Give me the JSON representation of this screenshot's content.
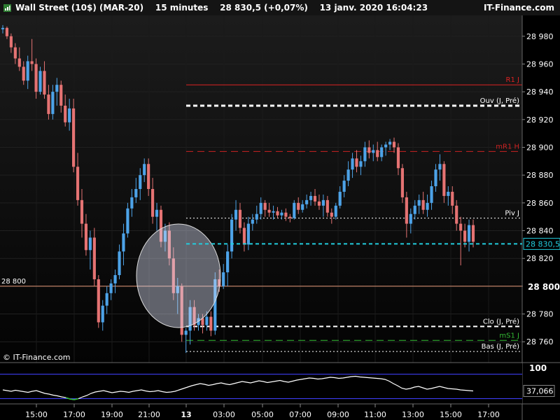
{
  "header": {
    "instrument": "Wall Street (10$) (MAR-20)",
    "timeframe": "15 minutes",
    "price": "28 830,5 (+0,07%)",
    "datetime": "13 janv. 2020 16:04:23",
    "brand": "IT-Finance.com"
  },
  "watermark": "© IT-Finance.com",
  "colors": {
    "up": "#4da3e8",
    "down": "#e57373",
    "background": "#000000",
    "oscillator": "#ffffff",
    "osc_band": "#4040ff",
    "last_price": "#22ccdd"
  },
  "chart_data": [
    {
      "type": "candlestick",
      "name": "Wall Street (10$) (MAR-20)",
      "ylim": [
        28745,
        28995
      ],
      "y_ticks": [
        28980,
        28960,
        28940,
        28920,
        28900,
        28880,
        28860,
        28840,
        28820,
        28800,
        28780,
        28760
      ],
      "y_tick_labels": [
        "28 980",
        "28 960",
        "28 940",
        "28 920",
        "28 900",
        "28 880",
        "28 860",
        "28 840",
        "28 820",
        "28 800",
        "28 780",
        "28 760"
      ],
      "x_labels": [
        "15:00",
        "17:00",
        "19:00",
        "21:00",
        "13",
        "03:00",
        "05:00",
        "07:00",
        "09:00",
        "11:00",
        "13:00",
        "15:00",
        "17:00"
      ],
      "last_price": 28830.5,
      "last_price_label": "28 830,5",
      "candles": [
        [
          28985,
          28988,
          28982,
          28986
        ],
        [
          28986,
          28987,
          28978,
          28980
        ],
        [
          28980,
          28982,
          28968,
          28972
        ],
        [
          28972,
          28975,
          28960,
          28964
        ],
        [
          28964,
          28972,
          28955,
          28958
        ],
        [
          28958,
          28962,
          28945,
          28948
        ],
        [
          28948,
          28966,
          28942,
          28962
        ],
        [
          28962,
          28978,
          28955,
          28960
        ],
        [
          28960,
          28964,
          28935,
          28940
        ],
        [
          28940,
          28958,
          28938,
          28955
        ],
        [
          28955,
          28962,
          28935,
          28938
        ],
        [
          28938,
          28945,
          28920,
          28924
        ],
        [
          28924,
          28945,
          28920,
          28940
        ],
        [
          28940,
          28950,
          28930,
          28945
        ],
        [
          28945,
          28948,
          28925,
          28930
        ],
        [
          28930,
          28938,
          28915,
          28918
        ],
        [
          28918,
          28935,
          28912,
          28928
        ],
        [
          28928,
          28935,
          28882,
          28886
        ],
        [
          28886,
          28896,
          28858,
          28862
        ],
        [
          28862,
          28870,
          28835,
          28845
        ],
        [
          28845,
          28852,
          28822,
          28826
        ],
        [
          28826,
          28840,
          28812,
          28835
        ],
        [
          28835,
          28842,
          28800,
          28805
        ],
        [
          28805,
          28808,
          28770,
          28774
        ],
        [
          28774,
          28790,
          28768,
          28786
        ],
        [
          28786,
          28800,
          28780,
          28795
        ],
        [
          28795,
          28805,
          28790,
          28802
        ],
        [
          28802,
          28812,
          28795,
          28808
        ],
        [
          28808,
          28830,
          28805,
          28825
        ],
        [
          28825,
          28845,
          28815,
          28838
        ],
        [
          28838,
          28860,
          28835,
          28856
        ],
        [
          28856,
          28870,
          28850,
          28864
        ],
        [
          28864,
          28878,
          28860,
          28870
        ],
        [
          28870,
          28885,
          28862,
          28880
        ],
        [
          28880,
          28892,
          28875,
          28888
        ],
        [
          28888,
          28892,
          28865,
          28870
        ],
        [
          28870,
          28878,
          28845,
          28850
        ],
        [
          28850,
          28860,
          28840,
          28855
        ],
        [
          28855,
          28858,
          28828,
          28832
        ],
        [
          28832,
          28845,
          28825,
          28840
        ],
        [
          28840,
          28846,
          28815,
          28820
        ],
        [
          28820,
          28828,
          28790,
          28795
        ],
        [
          28795,
          28806,
          28780,
          28800
        ],
        [
          28800,
          28802,
          28760,
          28765
        ],
        [
          28765,
          28770,
          28752,
          28768
        ],
        [
          28768,
          28790,
          28758,
          28785
        ],
        [
          28785,
          28790,
          28768,
          28772
        ],
        [
          28772,
          28780,
          28768,
          28777
        ],
        [
          28777,
          28780,
          28766,
          28772
        ],
        [
          28772,
          28782,
          28768,
          28778
        ],
        [
          28778,
          28782,
          28764,
          28768
        ],
        [
          28768,
          28810,
          28765,
          28805
        ],
        [
          28805,
          28812,
          28796,
          28800
        ],
        [
          28800,
          28816,
          28798,
          28810
        ],
        [
          28810,
          28830,
          28800,
          28825
        ],
        [
          28825,
          28852,
          28820,
          28848
        ],
        [
          28848,
          28862,
          28840,
          28855
        ],
        [
          28855,
          28860,
          28838,
          28842
        ],
        [
          28842,
          28846,
          28825,
          28830
        ],
        [
          28830,
          28850,
          28826,
          28845
        ],
        [
          28845,
          28852,
          28840,
          28848
        ],
        [
          28848,
          28858,
          28845,
          28852
        ],
        [
          28852,
          28864,
          28848,
          28860
        ],
        [
          28860,
          28862,
          28850,
          28855
        ],
        [
          28855,
          28860,
          28850,
          28853
        ],
        [
          28853,
          28858,
          28848,
          28854
        ],
        [
          28854,
          28857,
          28849,
          28851
        ],
        [
          28851,
          28855,
          28848,
          28853
        ],
        [
          28853,
          28856,
          28847,
          28850
        ],
        [
          28850,
          28852,
          28846,
          28849
        ],
        [
          28849,
          28862,
          28848,
          28860
        ],
        [
          28860,
          28864,
          28852,
          28855
        ],
        [
          28855,
          28862,
          28853,
          28859
        ],
        [
          28859,
          28866,
          28856,
          28862
        ],
        [
          28862,
          28868,
          28858,
          28865
        ],
        [
          28865,
          28870,
          28858,
          28861
        ],
        [
          28861,
          28866,
          28855,
          28858
        ],
        [
          28858,
          28866,
          28850,
          28862
        ],
        [
          28862,
          28865,
          28850,
          28853
        ],
        [
          28853,
          28856,
          28845,
          28850
        ],
        [
          28850,
          28860,
          28848,
          28858
        ],
        [
          28858,
          28872,
          28856,
          28868
        ],
        [
          28868,
          28880,
          28864,
          28876
        ],
        [
          28876,
          28890,
          28872,
          28884
        ],
        [
          28884,
          28896,
          28878,
          28892
        ],
        [
          28892,
          28898,
          28882,
          28886
        ],
        [
          28886,
          28894,
          28880,
          28890
        ],
        [
          28890,
          28904,
          28886,
          28900
        ],
        [
          28900,
          28905,
          28892,
          28896
        ],
        [
          28896,
          28902,
          28890,
          28898
        ],
        [
          28898,
          28904,
          28890,
          28893
        ],
        [
          28893,
          28902,
          28890,
          28900
        ],
        [
          28900,
          28904,
          28894,
          28902
        ],
        [
          28902,
          28906,
          28898,
          28904
        ],
        [
          28904,
          28907,
          28896,
          28900
        ],
        [
          28900,
          28903,
          28880,
          28885
        ],
        [
          28885,
          28888,
          28860,
          28864
        ],
        [
          28864,
          28868,
          28835,
          28845
        ],
        [
          28845,
          28856,
          28838,
          28852
        ],
        [
          28852,
          28862,
          28848,
          28858
        ],
        [
          28858,
          28866,
          28852,
          28862
        ],
        [
          28862,
          28868,
          28852,
          28855
        ],
        [
          28855,
          28866,
          28850,
          28860
        ],
        [
          28860,
          28876,
          28855,
          28872
        ],
        [
          28872,
          28888,
          28868,
          28884
        ],
        [
          28884,
          28895,
          28876,
          28888
        ],
        [
          28888,
          28890,
          28860,
          28865
        ],
        [
          28865,
          28872,
          28858,
          28868
        ],
        [
          28868,
          28872,
          28852,
          28858
        ],
        [
          28858,
          28862,
          28840,
          28845
        ],
        [
          28845,
          28850,
          28815,
          28840
        ],
        [
          28840,
          28845,
          28828,
          28832
        ],
        [
          28832,
          28848,
          28825,
          28844
        ],
        [
          28844,
          28848,
          28828,
          28832
        ]
      ],
      "levels": [
        {
          "label": "R1 J",
          "value": 28945,
          "color": "#dd2222",
          "style": "solid",
          "width": 1,
          "bold": false
        },
        {
          "label": "Ouv (J, Pré)",
          "value": 28930,
          "color": "#ffffff",
          "style": "dashed",
          "width": 3,
          "bold": false
        },
        {
          "label": "mR1 H",
          "value": 28897,
          "color": "#cc2222",
          "style": "longdash",
          "width": 1,
          "bold": false
        },
        {
          "label": "Piv J",
          "value": 28849,
          "color": "#ffffff",
          "style": "dotted",
          "width": 1,
          "bold": false
        },
        {
          "label": "28 800",
          "value": 28800,
          "color": "#e89a7a",
          "style": "solid",
          "width": 1,
          "bold": true
        },
        {
          "label": "Clo (J, Pré)",
          "value": 28771,
          "color": "#ffffff",
          "style": "dashed",
          "width": 2,
          "bold": false
        },
        {
          "label": "mS1 J",
          "value": 28761,
          "color": "#33bb33",
          "style": "longdash",
          "width": 1,
          "bold": false
        },
        {
          "label": "Bas (J, Pré)",
          "value": 28753,
          "color": "#ffffff",
          "style": "dotted",
          "width": 1,
          "bold": false
        }
      ],
      "horizontal_label_left": "28 800",
      "highlight": {
        "type": "ellipse",
        "fill": "rgba(220,225,245,0.42)",
        "stroke": "#dddddd"
      }
    },
    {
      "type": "line",
      "name": "oscillator",
      "ylim": [
        0,
        100
      ],
      "y_tick_labels": [
        "100"
      ],
      "last_value": 37.066,
      "last_value_label": "37,066",
      "bands": [
        85,
        15
      ],
      "values": [
        40,
        38,
        36,
        39,
        37,
        35,
        33,
        36,
        38,
        34,
        30,
        28,
        25,
        23,
        20,
        18,
        14,
        12,
        15,
        20,
        24,
        30,
        34,
        36,
        38,
        35,
        32,
        34,
        36,
        35,
        33,
        36,
        38,
        40,
        37,
        35,
        36,
        38,
        35,
        33,
        34,
        36,
        40,
        44,
        48,
        52,
        55,
        58,
        56,
        53,
        55,
        58,
        60,
        57,
        55,
        58,
        61,
        64,
        62,
        60,
        63,
        66,
        64,
        61,
        63,
        65,
        67,
        64,
        62,
        65,
        68,
        70,
        72,
        74,
        73,
        71,
        72,
        74,
        76,
        75,
        73,
        74,
        76,
        78,
        79,
        77,
        76,
        75,
        74,
        73,
        72,
        70,
        65,
        58,
        52,
        45,
        42,
        44,
        48,
        50,
        46,
        42,
        44,
        47,
        50,
        47,
        44,
        43,
        42,
        40,
        39,
        38,
        37
      ]
    }
  ]
}
